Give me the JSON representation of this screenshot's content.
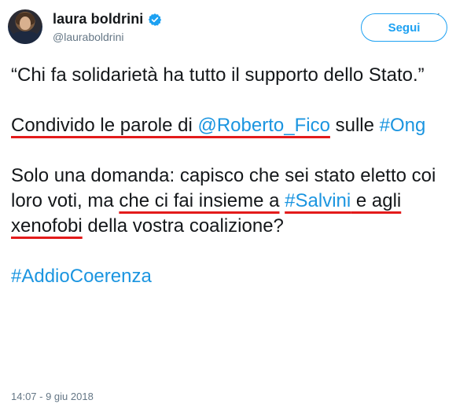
{
  "user": {
    "display_name": "laura boldrini",
    "handle": "@lauraboldrini",
    "verified_icon": "verified-badge-icon",
    "accent": "#1da1f2"
  },
  "follow_button": {
    "label": "Segui"
  },
  "menu": {
    "icon": "chevron-down-icon"
  },
  "tweet": {
    "p1": "“Chi fa solidarietà ha tutto il supporto dello Stato.”",
    "p2_a": "Condivido le parole di ",
    "p2_mention": "@Roberto_Fico",
    "p2_b": " sulle ",
    "p2_hashtag": "#Ong",
    "p3_a": "Solo una domanda: capisco che sei stato eletto coi loro voti, ma ",
    "p3_b": "che ci fai insieme a",
    "p3_c": " ",
    "p3_hashtag": "#Salvini",
    "p3_d": " e agli xenofobi",
    "p3_e": " della  vostra coalizione?",
    "p4_hashtag": "#AddioCoerenza",
    "annotation_color": "#e31b1b",
    "link_color": "#1b95e0"
  },
  "timestamp": "14:07 - 9 giu 2018"
}
